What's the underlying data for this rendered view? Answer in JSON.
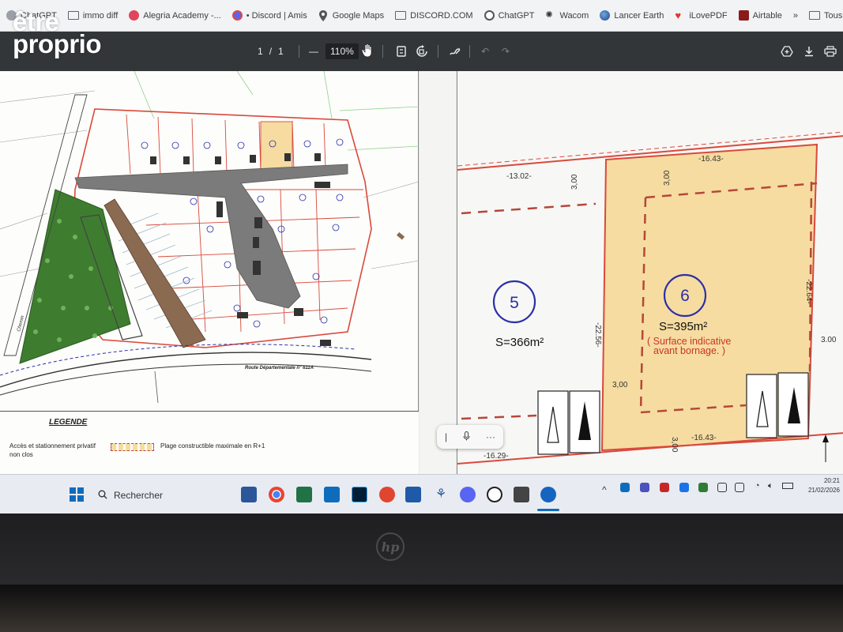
{
  "bookmarks": [
    {
      "label": "ChatGPT",
      "icon": "chatgpt-icon"
    },
    {
      "label": "immo diff",
      "icon": "folder-icon"
    },
    {
      "label": "Alegria Academy -...",
      "icon": "alegria-icon"
    },
    {
      "label": "• Discord | Amis",
      "icon": "discord-icon"
    },
    {
      "label": "Google Maps",
      "icon": "maps-pin-icon"
    },
    {
      "label": "DISCORD.COM",
      "icon": "folder-icon"
    },
    {
      "label": "ChatGPT",
      "icon": "chatgpt-icon"
    },
    {
      "label": "Wacom",
      "icon": "wacom-icon"
    },
    {
      "label": "Lancer Earth",
      "icon": "earth-icon"
    },
    {
      "label": "iLovePDF",
      "icon": "ilovepdf-icon"
    },
    {
      "label": "Airtable",
      "icon": "airtable-icon"
    }
  ],
  "bookmarks_more": "»",
  "bookmarks_all": "Tous les",
  "watermark": {
    "line1": "être",
    "line2": "proprio"
  },
  "pdf_toolbar": {
    "page_current": "1",
    "page_sep": "/",
    "page_total": "1",
    "zoom_minus": "—",
    "zoom_value": "110%",
    "zoom_plus": "+"
  },
  "plan": {
    "road_label": "Route Départementale n° 611A",
    "chemin_label": "Chemin",
    "legend_title": "LEGENDE",
    "legend_items": [
      {
        "label": "Accès et stationnement privatif non clos"
      },
      {
        "label": "Plage constructible maximale en R+1"
      }
    ]
  },
  "lots": {
    "lot5": {
      "number": "5",
      "surface": "S=366m²",
      "dims": {
        "top": "-13.02-",
        "setback": "3,00",
        "side": "-22.56-",
        "bottom": "-16.29-"
      }
    },
    "lot6": {
      "number": "6",
      "surface": "S=395m²",
      "note_line1": "( Surface indicative",
      "note_line2": "avant bornage. )",
      "dims": {
        "top": "-16.43-",
        "setback_top": "3,00",
        "side": "-22.64-",
        "left_setback": "3,00",
        "bottom_setback": "3,00",
        "bottom": "-16.43-",
        "right": "3.00"
      }
    }
  },
  "taskbar": {
    "search_placeholder": "Rechercher",
    "time": "20:21",
    "date": "21/02/2026",
    "tray_chevron": "^"
  },
  "colors": {
    "lot6_fill": "#f6dca0",
    "boundary_red": "#d9493c",
    "setback_dash": "#b5473a",
    "lot_number_circle": "#2b2fa8",
    "note_red": "#c8342b",
    "green_area": "#3e7d2f",
    "road_gray": "#7b7b7b"
  },
  "laptop_brand": "hp"
}
